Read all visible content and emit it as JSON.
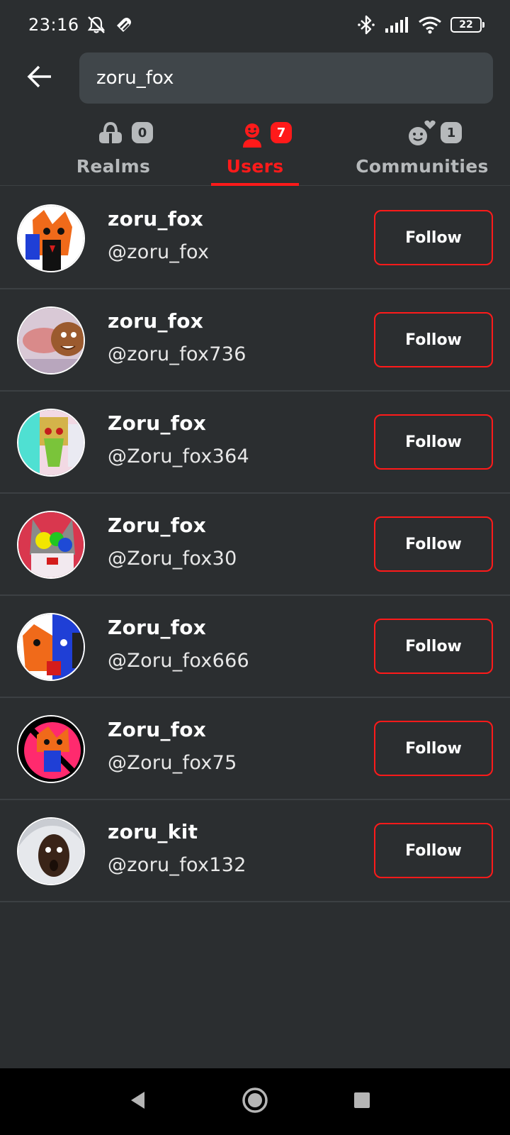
{
  "status_bar": {
    "time": "23:16",
    "battery": "22",
    "icons": [
      "mute-icon",
      "data-saver-icon",
      "bluetooth-icon",
      "signal-icon",
      "wifi-icon",
      "battery-icon"
    ]
  },
  "search": {
    "value": "zoru_fox",
    "back_icon": "arrow-left-icon"
  },
  "tabs": [
    {
      "label": "Realms",
      "count": "0",
      "icon": "realm-bag-icon",
      "active": false
    },
    {
      "label": "Users",
      "count": "7",
      "icon": "user-icon",
      "active": true
    },
    {
      "label": "Communities",
      "count": "1",
      "icon": "community-icon",
      "active": false
    }
  ],
  "users": [
    {
      "name": "zoru_fox",
      "handle": "@zoru_fox",
      "button": "Follow"
    },
    {
      "name": "zoru_fox",
      "handle": "@zoru_fox736",
      "button": "Follow"
    },
    {
      "name": "Zoru_fox",
      "handle": "@Zoru_fox364",
      "button": "Follow"
    },
    {
      "name": "Zoru_fox",
      "handle": "@Zoru_fox30",
      "button": "Follow"
    },
    {
      "name": "Zoru_fox",
      "handle": "@Zoru_fox666",
      "button": "Follow"
    },
    {
      "name": "Zoru_fox",
      "handle": "@Zoru_fox75",
      "button": "Follow"
    },
    {
      "name": "zoru_kit",
      "handle": "@zoru_fox132",
      "button": "Follow"
    }
  ],
  "colors": {
    "background": "#2b2e30",
    "accent": "#ff1a1a",
    "search_bg": "#40464a",
    "inactive_tab": "#b6b9bb"
  },
  "nav": [
    "back-triangle-icon",
    "home-circle-icon",
    "recents-square-icon"
  ]
}
